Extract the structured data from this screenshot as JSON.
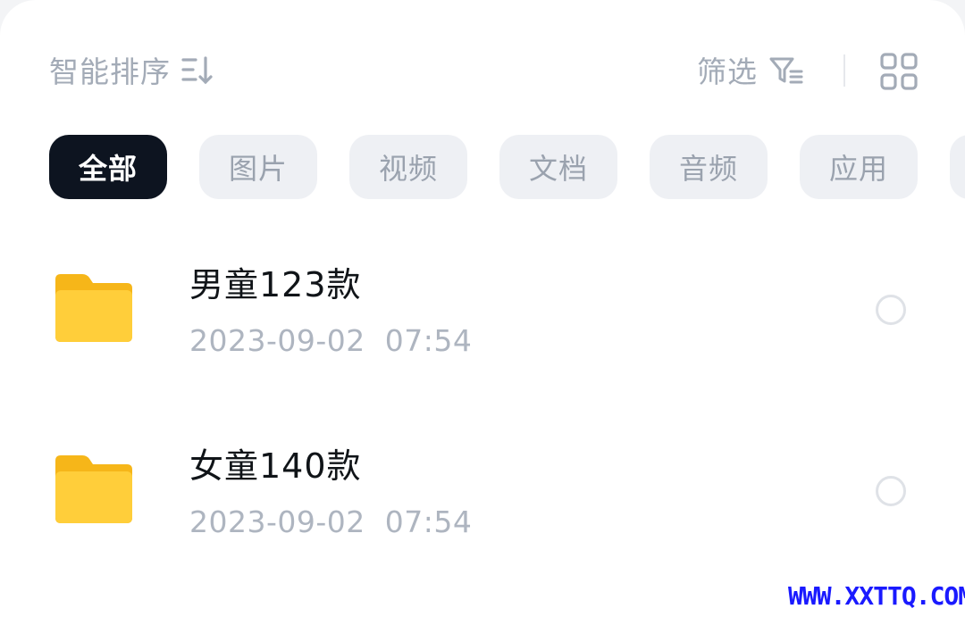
{
  "toolbar": {
    "sort_label": "智能排序",
    "filter_label": "筛选",
    "icons": {
      "sort": "sort-order-icon",
      "filter": "filter-funnel-icon",
      "view": "grid-view-icon"
    }
  },
  "tabs": [
    {
      "label": "全部",
      "active": true
    },
    {
      "label": "图片",
      "active": false
    },
    {
      "label": "视频",
      "active": false
    },
    {
      "label": "文档",
      "active": false
    },
    {
      "label": "音频",
      "active": false
    },
    {
      "label": "应用",
      "active": false
    }
  ],
  "files": [
    {
      "name": "男童123款",
      "date": "2023-09-02  07:54",
      "type": "folder"
    },
    {
      "name": "女童140款",
      "date": "2023-09-02  07:54",
      "type": "folder"
    }
  ],
  "watermark": "WWW.XXTTQ.COM",
  "colors": {
    "active_tab": "#0d1420",
    "folder": "#ffc830",
    "watermark": "#1a1aff"
  }
}
